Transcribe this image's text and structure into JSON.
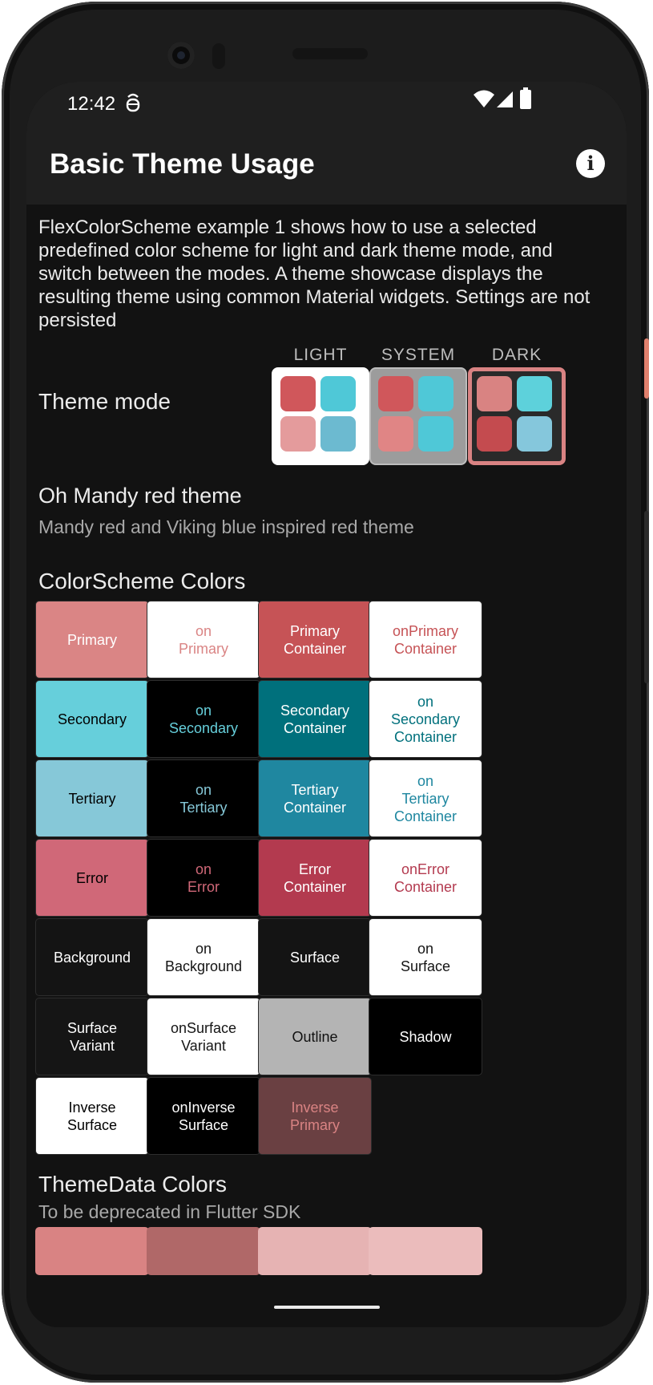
{
  "status_bar": {
    "time": "12:42"
  },
  "app_bar": {
    "title": "Basic Theme Usage"
  },
  "intro": "FlexColorScheme example 1 shows how to use a selected predefined color scheme for light and dark theme mode, and switch between the modes. A theme showcase displays the resulting theme using common Material widgets. Settings are not persisted",
  "theme_mode": {
    "label": "Theme mode",
    "options": [
      {
        "label": "LIGHT",
        "selected": false,
        "swatches": [
          "#d0575b",
          "#4fc8d7",
          "#e49b9c",
          "#6cbad0"
        ]
      },
      {
        "label": "SYSTEM",
        "selected": false,
        "swatches": [
          "#d0575b",
          "#4fc8d7",
          "#e08585",
          "#4fc8d7"
        ]
      },
      {
        "label": "DARK",
        "selected": true,
        "swatches": [
          "#d98382",
          "#5dd1db",
          "#c44b4f",
          "#85c7dc"
        ]
      }
    ]
  },
  "scheme": {
    "name": "Oh Mandy red theme",
    "description": "Mandy red and Viking blue inspired red theme"
  },
  "colorscheme_section": {
    "title": "ColorScheme Colors",
    "rows": [
      [
        {
          "label": "Primary",
          "bg": "#da8585",
          "fg": "#ffffff"
        },
        {
          "label": "on\nPrimary",
          "bg": "#ffffff",
          "fg": "#da8585"
        },
        {
          "label": "Primary\nContainer",
          "bg": "#c65356",
          "fg": "#ffffff"
        },
        {
          "label": "onPrimary\nContainer",
          "bg": "#ffffff",
          "fg": "#c65356"
        }
      ],
      [
        {
          "label": "Secondary",
          "bg": "#66cfdb",
          "fg": "#000000"
        },
        {
          "label": "on\nSecondary",
          "bg": "#000000",
          "fg": "#66cfdb"
        },
        {
          "label": "Secondary\nContainer",
          "bg": "#00707c",
          "fg": "#ffffff"
        },
        {
          "label": "on\nSecondary\nContainer",
          "bg": "#ffffff",
          "fg": "#00707c"
        }
      ],
      [
        {
          "label": "Tertiary",
          "bg": "#86c8d8",
          "fg": "#000000"
        },
        {
          "label": "on\nTertiary",
          "bg": "#000000",
          "fg": "#86c8d8"
        },
        {
          "label": "Tertiary\nContainer",
          "bg": "#1f87a0",
          "fg": "#ffffff"
        },
        {
          "label": "on\nTertiary\nContainer",
          "bg": "#ffffff",
          "fg": "#1f87a0"
        }
      ],
      [
        {
          "label": "Error",
          "bg": "#d06878",
          "fg": "#000000"
        },
        {
          "label": "on\nError",
          "bg": "#000000",
          "fg": "#d06878"
        },
        {
          "label": "Error\nContainer",
          "bg": "#b33a4f",
          "fg": "#ffffff"
        },
        {
          "label": "onError\nContainer",
          "bg": "#ffffff",
          "fg": "#b33a4f"
        }
      ],
      [
        {
          "label": "Background",
          "bg": "#141414",
          "fg": "#ffffff"
        },
        {
          "label": "on\nBackground",
          "bg": "#ffffff",
          "fg": "#141414"
        },
        {
          "label": "Surface",
          "bg": "#141414",
          "fg": "#ffffff"
        },
        {
          "label": "on\nSurface",
          "bg": "#ffffff",
          "fg": "#141414"
        }
      ],
      [
        {
          "label": "Surface\nVariant",
          "bg": "#151515",
          "fg": "#ffffff"
        },
        {
          "label": "onSurface\nVariant",
          "bg": "#ffffff",
          "fg": "#151515"
        },
        {
          "label": "Outline",
          "bg": "#b4b4b4",
          "fg": "#111111"
        },
        {
          "label": "Shadow",
          "bg": "#000000",
          "fg": "#ffffff"
        }
      ],
      [
        {
          "label": "Inverse\nSurface",
          "bg": "#ffffff",
          "fg": "#000000"
        },
        {
          "label": "onInverse\nSurface",
          "bg": "#000000",
          "fg": "#ffffff"
        },
        {
          "label": "Inverse\nPrimary",
          "bg": "#6a4042",
          "fg": "#d98383"
        }
      ]
    ]
  },
  "themedata_section": {
    "title": "ThemeData Colors",
    "subtitle": "To be deprecated in Flutter SDK",
    "swatches": [
      "#d98383",
      "#b06868",
      "#e6b3b3",
      "#ebbcbc"
    ]
  }
}
